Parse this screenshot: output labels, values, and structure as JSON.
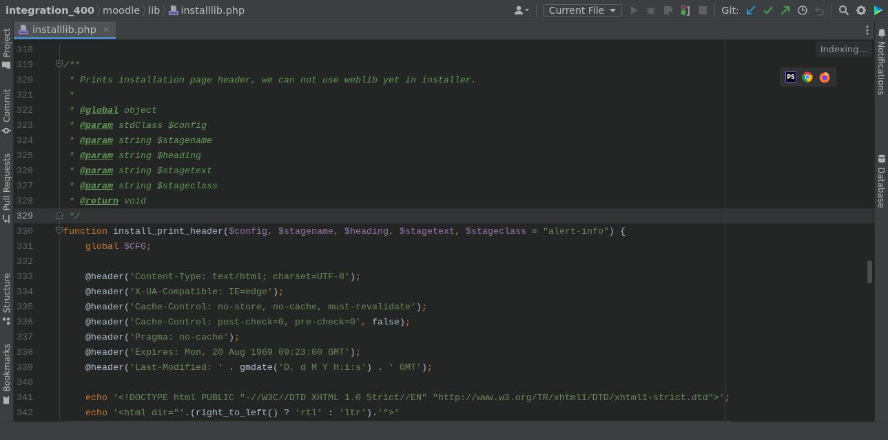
{
  "breadcrumbs": [
    {
      "label": "integration_400",
      "file": false
    },
    {
      "label": "moodle",
      "file": false
    },
    {
      "label": "lib",
      "file": false
    },
    {
      "label": "installlib.php",
      "file": true
    }
  ],
  "toolbar": {
    "run_config": "Current File",
    "git_label": "Git:",
    "icons": [
      {
        "kind": "user",
        "disabled": false
      },
      {
        "kind": "run",
        "disabled": true
      },
      {
        "kind": "debug",
        "disabled": true
      },
      {
        "kind": "coverage",
        "disabled": true
      },
      {
        "kind": "profile",
        "disabled": false
      },
      {
        "kind": "stop",
        "disabled": true
      },
      {
        "kind": "update",
        "disabled": false
      },
      {
        "kind": "commit",
        "disabled": false
      },
      {
        "kind": "push",
        "disabled": false
      },
      {
        "kind": "history",
        "disabled": false
      },
      {
        "kind": "rollback",
        "disabled": true
      },
      {
        "kind": "search",
        "disabled": false
      },
      {
        "kind": "settings",
        "disabled": false
      },
      {
        "kind": "toolbox",
        "disabled": false
      }
    ]
  },
  "tabs": [
    {
      "label": "installlib.php",
      "close": "×",
      "selected": true
    }
  ],
  "left_stripe": [
    {
      "label": "Project",
      "kind": "folder",
      "selected": false
    },
    {
      "label": "Commit",
      "kind": "commit",
      "selected": false
    },
    {
      "label": "Pull Requests",
      "kind": "pull",
      "selected": false
    },
    {
      "label": "Structure",
      "kind": "structure",
      "selected": false
    },
    {
      "label": "Bookmarks",
      "kind": "bookmark",
      "selected": false
    }
  ],
  "right_stripe": [
    {
      "label": "Notifications",
      "kind": "bell",
      "selected": false
    },
    {
      "label": "Database",
      "kind": "database",
      "selected": false
    }
  ],
  "indexing": "Indexing...",
  "browsers": [
    {
      "kind": "ps",
      "text": "PS"
    },
    {
      "kind": "round"
    },
    {
      "kind": "fox"
    }
  ],
  "lines": [
    {
      "number": "318",
      "fold_start": false,
      "fold_end": false,
      "current": false
    },
    {
      "number": "319",
      "fold_start": true,
      "fold_end": false,
      "current": false,
      "tokens": [
        {
          "kind": "comment",
          "text": "/**"
        }
      ]
    },
    {
      "number": "320",
      "fold_start": false,
      "fold_end": false,
      "current": false,
      "tokens": [
        {
          "kind": "comment",
          "text": " * Prints installation page header, we can not use weblib yet in installer."
        }
      ]
    },
    {
      "number": "321",
      "fold_start": false,
      "fold_end": false,
      "current": false,
      "tokens": [
        {
          "kind": "comment",
          "text": " *"
        }
      ]
    },
    {
      "number": "322",
      "fold_start": false,
      "fold_end": false,
      "current": false,
      "tokens": [
        {
          "kind": "comment",
          "text": " * "
        },
        {
          "kind": "doctag",
          "text": "@global"
        },
        {
          "kind": "comment",
          "text": " object"
        }
      ]
    },
    {
      "number": "323",
      "fold_start": false,
      "fold_end": false,
      "current": false,
      "tokens": [
        {
          "kind": "comment",
          "text": " * "
        },
        {
          "kind": "doctag",
          "text": "@param"
        },
        {
          "kind": "comment",
          "text": " stdClass $config"
        }
      ]
    },
    {
      "number": "324",
      "fold_start": false,
      "fold_end": false,
      "current": false,
      "tokens": [
        {
          "kind": "comment",
          "text": " * "
        },
        {
          "kind": "doctag",
          "text": "@param"
        },
        {
          "kind": "comment",
          "text": " string $stagename"
        }
      ]
    },
    {
      "number": "325",
      "fold_start": false,
      "fold_end": false,
      "current": false,
      "tokens": [
        {
          "kind": "comment",
          "text": " * "
        },
        {
          "kind": "doctag",
          "text": "@param"
        },
        {
          "kind": "comment",
          "text": " string $heading"
        }
      ]
    },
    {
      "number": "326",
      "fold_start": false,
      "fold_end": false,
      "current": false,
      "tokens": [
        {
          "kind": "comment",
          "text": " * "
        },
        {
          "kind": "doctag",
          "text": "@param"
        },
        {
          "kind": "comment",
          "text": " string $stagetext"
        }
      ]
    },
    {
      "number": "327",
      "fold_start": false,
      "fold_end": false,
      "current": false,
      "tokens": [
        {
          "kind": "comment",
          "text": " * "
        },
        {
          "kind": "doctag",
          "text": "@param"
        },
        {
          "kind": "comment",
          "text": " string $stageclass"
        }
      ]
    },
    {
      "number": "328",
      "fold_start": false,
      "fold_end": false,
      "current": false,
      "tokens": [
        {
          "kind": "comment",
          "text": " * "
        },
        {
          "kind": "doctag",
          "text": "@return"
        },
        {
          "kind": "comment",
          "text": " void"
        }
      ]
    },
    {
      "number": "329",
      "fold_start": false,
      "fold_end": true,
      "current": true,
      "tokens": [
        {
          "kind": "comment",
          "text": " */"
        }
      ]
    },
    {
      "number": "330",
      "fold_start": true,
      "fold_end": false,
      "current": false,
      "tokens": [
        {
          "kind": "keyword",
          "text": "function"
        },
        {
          "kind": "plain",
          "text": " install_print_header("
        },
        {
          "kind": "variable",
          "text": "$config"
        },
        {
          "kind": "punct",
          "text": ", "
        },
        {
          "kind": "variable",
          "text": "$stagename"
        },
        {
          "kind": "punct",
          "text": ", "
        },
        {
          "kind": "variable",
          "text": "$heading"
        },
        {
          "kind": "punct",
          "text": ", "
        },
        {
          "kind": "variable",
          "text": "$stagetext"
        },
        {
          "kind": "punct",
          "text": ", "
        },
        {
          "kind": "variable",
          "text": "$stageclass"
        },
        {
          "kind": "plain",
          "text": " = "
        },
        {
          "kind": "string",
          "text": "\"alert-info\""
        },
        {
          "kind": "plain",
          "text": ") {"
        }
      ]
    },
    {
      "number": "331",
      "fold_start": false,
      "fold_end": false,
      "current": false,
      "tokens": [
        {
          "kind": "keyword",
          "text": "    global"
        },
        {
          "kind": "variable",
          "text": " $CFG"
        },
        {
          "kind": "punct",
          "text": ";"
        }
      ]
    },
    {
      "number": "332",
      "fold_start": false,
      "fold_end": false,
      "current": false
    },
    {
      "number": "333",
      "fold_start": false,
      "fold_end": false,
      "current": false,
      "tokens": [
        {
          "kind": "plain",
          "text": "    @header("
        },
        {
          "kind": "string",
          "text": "'Content-Type: text/html; charset=UTF-8'"
        },
        {
          "kind": "plain",
          "text": ")"
        },
        {
          "kind": "punct",
          "text": ";"
        }
      ]
    },
    {
      "number": "334",
      "fold_start": false,
      "fold_end": false,
      "current": false,
      "tokens": [
        {
          "kind": "plain",
          "text": "    @header("
        },
        {
          "kind": "string",
          "text": "'X-UA-Compatible: IE=edge'"
        },
        {
          "kind": "plain",
          "text": ")"
        },
        {
          "kind": "punct",
          "text": ";"
        }
      ]
    },
    {
      "number": "335",
      "fold_start": false,
      "fold_end": false,
      "current": false,
      "tokens": [
        {
          "kind": "plain",
          "text": "    @header("
        },
        {
          "kind": "string",
          "text": "'Cache-Control: no-store, no-cache, must-revalidate'"
        },
        {
          "kind": "plain",
          "text": ")"
        },
        {
          "kind": "punct",
          "text": ";"
        }
      ]
    },
    {
      "number": "336",
      "fold_start": false,
      "fold_end": false,
      "current": false,
      "tokens": [
        {
          "kind": "plain",
          "text": "    @header("
        },
        {
          "kind": "string",
          "text": "'Cache-Control: post-check=0, pre-check=0'"
        },
        {
          "kind": "punct",
          "text": ", "
        },
        {
          "kind": "plain",
          "text": "false)"
        },
        {
          "kind": "punct",
          "text": ";"
        }
      ]
    },
    {
      "number": "337",
      "fold_start": false,
      "fold_end": false,
      "current": false,
      "tokens": [
        {
          "kind": "plain",
          "text": "    @header("
        },
        {
          "kind": "string",
          "text": "'Pragma: no-cache'"
        },
        {
          "kind": "plain",
          "text": ")"
        },
        {
          "kind": "punct",
          "text": ";"
        }
      ]
    },
    {
      "number": "338",
      "fold_start": false,
      "fold_end": false,
      "current": false,
      "tokens": [
        {
          "kind": "plain",
          "text": "    @header("
        },
        {
          "kind": "string",
          "text": "'Expires: Mon, 20 Aug 1969 09:23:00 GMT'"
        },
        {
          "kind": "plain",
          "text": ")"
        },
        {
          "kind": "punct",
          "text": ";"
        }
      ]
    },
    {
      "number": "339",
      "fold_start": false,
      "fold_end": false,
      "current": false,
      "tokens": [
        {
          "kind": "plain",
          "text": "    @header("
        },
        {
          "kind": "string",
          "text": "'Last-Modified: '"
        },
        {
          "kind": "plain",
          "text": " . gmdate("
        },
        {
          "kind": "string",
          "text": "'D, d M Y H:i:s'"
        },
        {
          "kind": "plain",
          "text": ") . "
        },
        {
          "kind": "string",
          "text": "' GMT'"
        },
        {
          "kind": "plain",
          "text": ")"
        },
        {
          "kind": "punct",
          "text": ";"
        }
      ]
    },
    {
      "number": "340",
      "fold_start": false,
      "fold_end": false,
      "current": false
    },
    {
      "number": "341",
      "fold_start": false,
      "fold_end": false,
      "current": false,
      "tokens": [
        {
          "kind": "keyword",
          "text": "    echo"
        },
        {
          "kind": "string",
          "text": " '<!DOCTYPE html PUBLIC \"-//W3C//DTD XHTML 1.0 Strict//EN\" \"http://www.w3.org/TR/xhtml1/DTD/xhtml1-strict.dtd\">'"
        },
        {
          "kind": "punct",
          "text": ";"
        }
      ]
    },
    {
      "number": "342",
      "fold_start": false,
      "fold_end": false,
      "current": false,
      "tokens": [
        {
          "kind": "keyword",
          "text": "    echo"
        },
        {
          "kind": "string",
          "text": " '<html dir=\"'"
        },
        {
          "kind": "plain",
          "text": ".(right_to_left() ? "
        },
        {
          "kind": "string",
          "text": "'rtl'"
        },
        {
          "kind": "plain",
          "text": " : "
        },
        {
          "kind": "string",
          "text": "'ltr'"
        },
        {
          "kind": "plain",
          "text": ")."
        },
        {
          "kind": "string",
          "text": "'\">'"
        }
      ]
    }
  ]
}
